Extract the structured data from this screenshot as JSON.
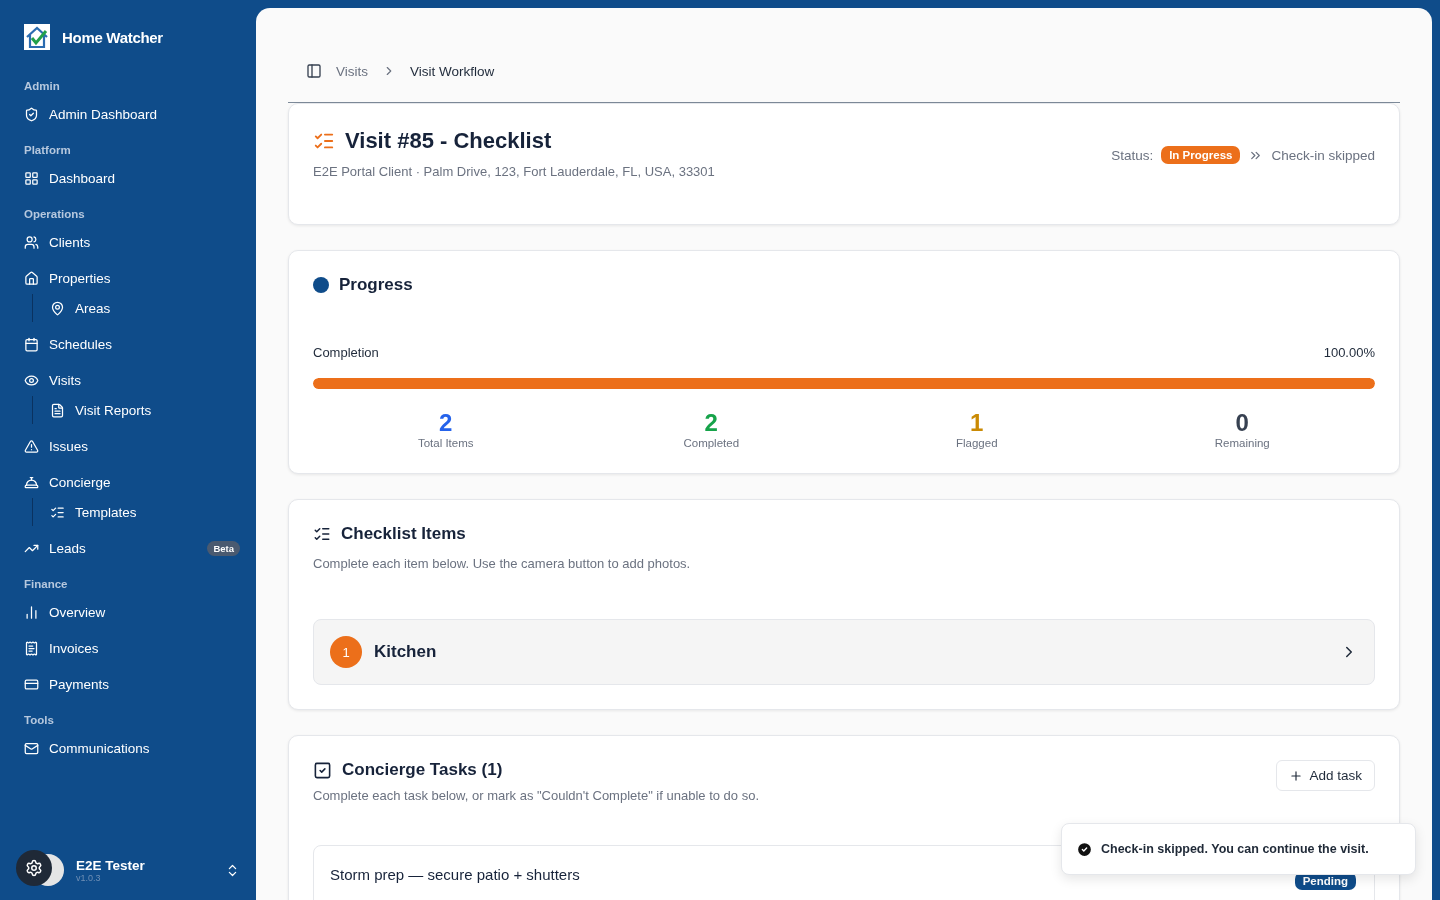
{
  "app": {
    "name": "Home Watcher"
  },
  "sidebar": {
    "sections": [
      {
        "title": "Admin",
        "items": [
          {
            "label": "Admin Dashboard"
          }
        ]
      },
      {
        "title": "Platform",
        "items": [
          {
            "label": "Dashboard"
          }
        ]
      },
      {
        "title": "Operations",
        "items": [
          {
            "label": "Clients"
          },
          {
            "label": "Properties",
            "children": [
              {
                "label": "Areas"
              }
            ]
          },
          {
            "label": "Schedules"
          },
          {
            "label": "Visits",
            "children": [
              {
                "label": "Visit Reports"
              }
            ]
          },
          {
            "label": "Issues"
          },
          {
            "label": "Concierge",
            "children": [
              {
                "label": "Templates"
              }
            ]
          },
          {
            "label": "Leads",
            "badge": "Beta"
          }
        ]
      },
      {
        "title": "Finance",
        "items": [
          {
            "label": "Overview"
          },
          {
            "label": "Invoices"
          },
          {
            "label": "Payments"
          }
        ]
      },
      {
        "title": "Tools",
        "items": [
          {
            "label": "Communications"
          }
        ]
      }
    ],
    "user": {
      "name": "E2E Tester",
      "version": "v1.0.3"
    }
  },
  "breadcrumb": [
    "Visits",
    "Visit Workflow"
  ],
  "header": {
    "title": "Visit #85 - Checklist",
    "client": "E2E Portal Client",
    "separator": "·",
    "address": "Palm Drive, 123, Fort Lauderdale, FL, USA, 33301",
    "status_label": "Status:",
    "status": "In Progress",
    "checkin": "Check-in skipped"
  },
  "progress": {
    "title": "Progress",
    "label": "Completion",
    "reading": "100.00%",
    "level": 1,
    "stats": [
      {
        "value": "2",
        "label": "Total Items",
        "color": "#2563eb"
      },
      {
        "value": "2",
        "label": "Completed",
        "color": "#16a34a"
      },
      {
        "value": "1",
        "label": "Flagged",
        "color": "#ca8a04"
      },
      {
        "value": "0",
        "label": "Remaining",
        "color": "#374151"
      }
    ]
  },
  "checklist": {
    "title": "Checklist Items",
    "description": "Complete each item below. Use the camera button to add photos.",
    "areas": [
      {
        "number": "1",
        "name": "Kitchen"
      }
    ]
  },
  "concierge": {
    "title": "Concierge Tasks (1)",
    "description": "Complete each task below, or mark as \"Couldn't Complete\" if unable to do so.",
    "add_button": "Add task",
    "tasks": [
      {
        "title": "Storm prep — secure patio + shutters",
        "status": "Pending"
      }
    ]
  },
  "toast": {
    "message": "Check-in skipped. You can continue the visit."
  }
}
